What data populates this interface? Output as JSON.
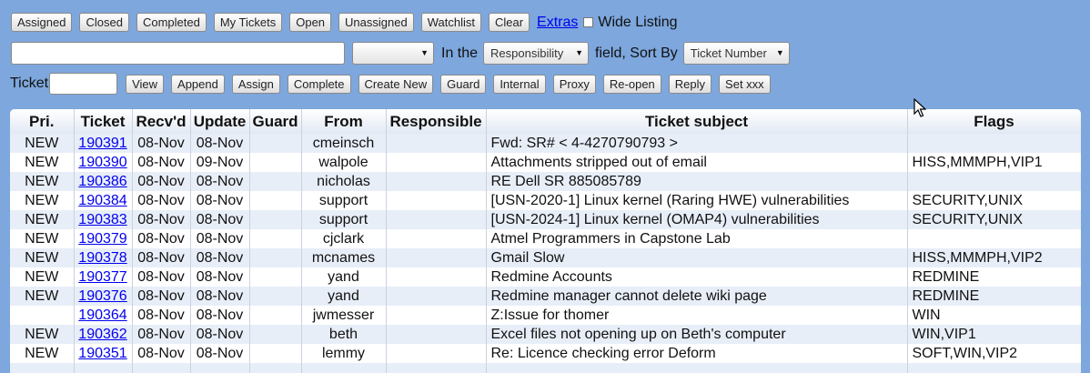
{
  "toolbar": {
    "buttons": [
      "Assigned",
      "Closed",
      "Completed",
      "My Tickets",
      "Open",
      "Unassigned",
      "Watchlist",
      "Clear"
    ],
    "extras_link": "Extras",
    "wide_listing_label": "Wide Listing"
  },
  "search": {
    "query_value": "",
    "mode_value": "",
    "in_the_label": "In the",
    "field_value": "Responsibility",
    "field_suffix": "field, Sort By",
    "sort_value": "Ticket Number"
  },
  "ticket_bar": {
    "label": "Ticket",
    "ticket_value": "",
    "buttons": [
      "View",
      "Append",
      "Assign",
      "Complete",
      "Create New",
      "Guard",
      "Internal",
      "Proxy",
      "Re-open",
      "Reply",
      "Set xxx"
    ]
  },
  "table": {
    "headers": [
      "Pri.",
      "Ticket",
      "Recv'd",
      "Update",
      "Guard",
      "From",
      "Responsible",
      "Ticket subject",
      "Flags"
    ],
    "rows": [
      [
        "NEW",
        "190391",
        "08-Nov",
        "08-Nov",
        "",
        "cmeinsch",
        "",
        "Fwd: SR# < 4-4270790793 >",
        ""
      ],
      [
        "NEW",
        "190390",
        "08-Nov",
        "09-Nov",
        "",
        "walpole",
        "",
        "Attachments stripped out of email",
        "HISS,MMMPH,VIP1"
      ],
      [
        "NEW",
        "190386",
        "08-Nov",
        "08-Nov",
        "",
        "nicholas",
        "",
        "RE Dell SR 885085789",
        ""
      ],
      [
        "NEW",
        "190384",
        "08-Nov",
        "08-Nov",
        "",
        "support",
        "",
        "[USN-2020-1] Linux kernel (Raring HWE) vulnerabilities",
        "SECURITY,UNIX"
      ],
      [
        "NEW",
        "190383",
        "08-Nov",
        "08-Nov",
        "",
        "support",
        "",
        "[USN-2024-1] Linux kernel (OMAP4) vulnerabilities",
        "SECURITY,UNIX"
      ],
      [
        "NEW",
        "190379",
        "08-Nov",
        "08-Nov",
        "",
        "cjclark",
        "",
        "Atmel Programmers in Capstone Lab",
        ""
      ],
      [
        "NEW",
        "190378",
        "08-Nov",
        "08-Nov",
        "",
        "mcnames",
        "",
        "Gmail Slow",
        "HISS,MMMPH,VIP2"
      ],
      [
        "NEW",
        "190377",
        "08-Nov",
        "08-Nov",
        "",
        "yand",
        "",
        "Redmine Accounts",
        "REDMINE"
      ],
      [
        "NEW",
        "190376",
        "08-Nov",
        "08-Nov",
        "",
        "yand",
        "",
        "Redmine manager cannot delete wiki page",
        "REDMINE"
      ],
      [
        "",
        "190364",
        "08-Nov",
        "08-Nov",
        "",
        "jwmesser",
        "",
        "Z:Issue for thomer",
        "WIN"
      ],
      [
        "NEW",
        "190362",
        "08-Nov",
        "08-Nov",
        "",
        "beth",
        "",
        "Excel files not opening up on Beth's computer",
        "WIN,VIP1"
      ],
      [
        "NEW",
        "190351",
        "08-Nov",
        "08-Nov",
        "",
        "lemmy",
        "",
        "Re: Licence checking error Deform",
        "SOFT,WIN,VIP2"
      ],
      [
        "",
        "",
        "",
        "",
        "",
        "",
        "",
        "",
        ""
      ]
    ]
  }
}
